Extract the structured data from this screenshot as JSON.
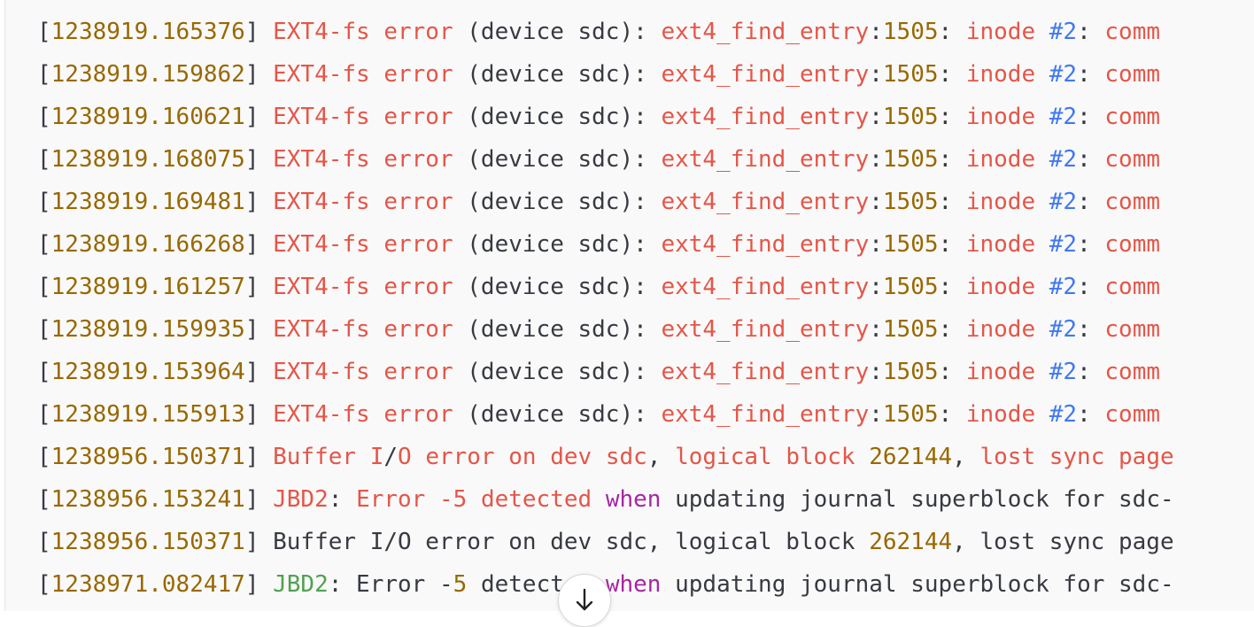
{
  "log_lines": [
    [
      {
        "t": "[",
        "c": "plain"
      },
      {
        "t": "1238919.165376",
        "c": "num"
      },
      {
        "t": "] ",
        "c": "plain"
      },
      {
        "t": "EXT4-fs error",
        "c": "red"
      },
      {
        "t": " (device sdc): ",
        "c": "plain"
      },
      {
        "t": "ext4_find_entry",
        "c": "red"
      },
      {
        "t": ":",
        "c": "plain"
      },
      {
        "t": "1505",
        "c": "num"
      },
      {
        "t": ": ",
        "c": "plain"
      },
      {
        "t": "inode",
        "c": "red"
      },
      {
        "t": " ",
        "c": "plain"
      },
      {
        "t": "#2",
        "c": "blue"
      },
      {
        "t": ": ",
        "c": "plain"
      },
      {
        "t": "comm",
        "c": "red"
      }
    ],
    [
      {
        "t": "[",
        "c": "plain"
      },
      {
        "t": "1238919.159862",
        "c": "num"
      },
      {
        "t": "] ",
        "c": "plain"
      },
      {
        "t": "EXT4-fs error",
        "c": "red"
      },
      {
        "t": " (device sdc): ",
        "c": "plain"
      },
      {
        "t": "ext4_find_entry",
        "c": "red"
      },
      {
        "t": ":",
        "c": "plain"
      },
      {
        "t": "1505",
        "c": "num"
      },
      {
        "t": ": ",
        "c": "plain"
      },
      {
        "t": "inode",
        "c": "red"
      },
      {
        "t": " ",
        "c": "plain"
      },
      {
        "t": "#2",
        "c": "blue"
      },
      {
        "t": ": ",
        "c": "plain"
      },
      {
        "t": "comm",
        "c": "red"
      }
    ],
    [
      {
        "t": "[",
        "c": "plain"
      },
      {
        "t": "1238919.160621",
        "c": "num"
      },
      {
        "t": "] ",
        "c": "plain"
      },
      {
        "t": "EXT4-fs error",
        "c": "red"
      },
      {
        "t": " (device sdc): ",
        "c": "plain"
      },
      {
        "t": "ext4_find_entry",
        "c": "red"
      },
      {
        "t": ":",
        "c": "plain"
      },
      {
        "t": "1505",
        "c": "num"
      },
      {
        "t": ": ",
        "c": "plain"
      },
      {
        "t": "inode",
        "c": "red"
      },
      {
        "t": " ",
        "c": "plain"
      },
      {
        "t": "#2",
        "c": "blue"
      },
      {
        "t": ": ",
        "c": "plain"
      },
      {
        "t": "comm",
        "c": "red"
      }
    ],
    [
      {
        "t": "[",
        "c": "plain"
      },
      {
        "t": "1238919.168075",
        "c": "num"
      },
      {
        "t": "] ",
        "c": "plain"
      },
      {
        "t": "EXT4-fs error",
        "c": "red"
      },
      {
        "t": " (device sdc): ",
        "c": "plain"
      },
      {
        "t": "ext4_find_entry",
        "c": "red"
      },
      {
        "t": ":",
        "c": "plain"
      },
      {
        "t": "1505",
        "c": "num"
      },
      {
        "t": ": ",
        "c": "plain"
      },
      {
        "t": "inode",
        "c": "red"
      },
      {
        "t": " ",
        "c": "plain"
      },
      {
        "t": "#2",
        "c": "blue"
      },
      {
        "t": ": ",
        "c": "plain"
      },
      {
        "t": "comm",
        "c": "red"
      }
    ],
    [
      {
        "t": "[",
        "c": "plain"
      },
      {
        "t": "1238919.169481",
        "c": "num"
      },
      {
        "t": "] ",
        "c": "plain"
      },
      {
        "t": "EXT4-fs error",
        "c": "red"
      },
      {
        "t": " (device sdc): ",
        "c": "plain"
      },
      {
        "t": "ext4_find_entry",
        "c": "red"
      },
      {
        "t": ":",
        "c": "plain"
      },
      {
        "t": "1505",
        "c": "num"
      },
      {
        "t": ": ",
        "c": "plain"
      },
      {
        "t": "inode",
        "c": "red"
      },
      {
        "t": " ",
        "c": "plain"
      },
      {
        "t": "#2",
        "c": "blue"
      },
      {
        "t": ": ",
        "c": "plain"
      },
      {
        "t": "comm",
        "c": "red"
      }
    ],
    [
      {
        "t": "[",
        "c": "plain"
      },
      {
        "t": "1238919.166268",
        "c": "num"
      },
      {
        "t": "] ",
        "c": "plain"
      },
      {
        "t": "EXT4-fs error",
        "c": "red"
      },
      {
        "t": " (device sdc): ",
        "c": "plain"
      },
      {
        "t": "ext4_find_entry",
        "c": "red"
      },
      {
        "t": ":",
        "c": "plain"
      },
      {
        "t": "1505",
        "c": "num"
      },
      {
        "t": ": ",
        "c": "plain"
      },
      {
        "t": "inode",
        "c": "red"
      },
      {
        "t": " ",
        "c": "plain"
      },
      {
        "t": "#2",
        "c": "blue"
      },
      {
        "t": ": ",
        "c": "plain"
      },
      {
        "t": "comm",
        "c": "red"
      }
    ],
    [
      {
        "t": "[",
        "c": "plain"
      },
      {
        "t": "1238919.161257",
        "c": "num"
      },
      {
        "t": "] ",
        "c": "plain"
      },
      {
        "t": "EXT4-fs error",
        "c": "red"
      },
      {
        "t": " (device sdc): ",
        "c": "plain"
      },
      {
        "t": "ext4_find_entry",
        "c": "red"
      },
      {
        "t": ":",
        "c": "plain"
      },
      {
        "t": "1505",
        "c": "num"
      },
      {
        "t": ": ",
        "c": "plain"
      },
      {
        "t": "inode",
        "c": "red"
      },
      {
        "t": " ",
        "c": "plain"
      },
      {
        "t": "#2",
        "c": "blue"
      },
      {
        "t": ": ",
        "c": "plain"
      },
      {
        "t": "comm",
        "c": "red"
      }
    ],
    [
      {
        "t": "[",
        "c": "plain"
      },
      {
        "t": "1238919.159935",
        "c": "num"
      },
      {
        "t": "] ",
        "c": "plain"
      },
      {
        "t": "EXT4-fs error",
        "c": "red"
      },
      {
        "t": " (device sdc): ",
        "c": "plain"
      },
      {
        "t": "ext4_find_entry",
        "c": "red"
      },
      {
        "t": ":",
        "c": "plain"
      },
      {
        "t": "1505",
        "c": "num"
      },
      {
        "t": ": ",
        "c": "plain"
      },
      {
        "t": "inode",
        "c": "red"
      },
      {
        "t": " ",
        "c": "plain"
      },
      {
        "t": "#2",
        "c": "blue"
      },
      {
        "t": ": ",
        "c": "plain"
      },
      {
        "t": "comm",
        "c": "red"
      }
    ],
    [
      {
        "t": "[",
        "c": "plain"
      },
      {
        "t": "1238919.153964",
        "c": "num"
      },
      {
        "t": "] ",
        "c": "plain"
      },
      {
        "t": "EXT4-fs error",
        "c": "red"
      },
      {
        "t": " (device sdc): ",
        "c": "plain"
      },
      {
        "t": "ext4_find_entry",
        "c": "red"
      },
      {
        "t": ":",
        "c": "plain"
      },
      {
        "t": "1505",
        "c": "num"
      },
      {
        "t": ": ",
        "c": "plain"
      },
      {
        "t": "inode",
        "c": "red"
      },
      {
        "t": " ",
        "c": "plain"
      },
      {
        "t": "#2",
        "c": "blue"
      },
      {
        "t": ": ",
        "c": "plain"
      },
      {
        "t": "comm",
        "c": "red"
      }
    ],
    [
      {
        "t": "[",
        "c": "plain"
      },
      {
        "t": "1238919.155913",
        "c": "num"
      },
      {
        "t": "] ",
        "c": "plain"
      },
      {
        "t": "EXT4-fs error",
        "c": "red"
      },
      {
        "t": " (device sdc): ",
        "c": "plain"
      },
      {
        "t": "ext4_find_entry",
        "c": "red"
      },
      {
        "t": ":",
        "c": "plain"
      },
      {
        "t": "1505",
        "c": "num"
      },
      {
        "t": ": ",
        "c": "plain"
      },
      {
        "t": "inode",
        "c": "red"
      },
      {
        "t": " ",
        "c": "plain"
      },
      {
        "t": "#2",
        "c": "blue"
      },
      {
        "t": ": ",
        "c": "plain"
      },
      {
        "t": "comm",
        "c": "red"
      }
    ],
    [
      {
        "t": "[",
        "c": "plain"
      },
      {
        "t": "1238956.150371",
        "c": "num"
      },
      {
        "t": "] ",
        "c": "plain"
      },
      {
        "t": "Buffer I",
        "c": "red"
      },
      {
        "t": "/",
        "c": "plain"
      },
      {
        "t": "O error on dev sdc",
        "c": "red"
      },
      {
        "t": ", ",
        "c": "plain"
      },
      {
        "t": "logical block ",
        "c": "red"
      },
      {
        "t": "262144",
        "c": "num"
      },
      {
        "t": ", ",
        "c": "plain"
      },
      {
        "t": "lost sync page",
        "c": "red"
      }
    ],
    [
      {
        "t": "[",
        "c": "plain"
      },
      {
        "t": "1238956.153241",
        "c": "num"
      },
      {
        "t": "] ",
        "c": "plain"
      },
      {
        "t": "JBD2",
        "c": "red"
      },
      {
        "t": ": ",
        "c": "plain"
      },
      {
        "t": "Error -5 detected",
        "c": "red"
      },
      {
        "t": " ",
        "c": "plain"
      },
      {
        "t": "when",
        "c": "purp"
      },
      {
        "t": " updating journal superblock for sdc-",
        "c": "plain"
      }
    ],
    [
      {
        "t": "[",
        "c": "plain"
      },
      {
        "t": "1238956.150371",
        "c": "num"
      },
      {
        "t": "] ",
        "c": "plain"
      },
      {
        "t": "Buffer I/O error on dev sdc, logical block ",
        "c": "plain"
      },
      {
        "t": "262144",
        "c": "num"
      },
      {
        "t": ", lost sync page",
        "c": "plain"
      }
    ],
    [
      {
        "t": "[",
        "c": "plain"
      },
      {
        "t": "1238971.082417",
        "c": "num"
      },
      {
        "t": "] ",
        "c": "plain"
      },
      {
        "t": "JBD2",
        "c": "green"
      },
      {
        "t": ": Error -",
        "c": "plain"
      },
      {
        "t": "5",
        "c": "num"
      },
      {
        "t": " detected ",
        "c": "plain"
      },
      {
        "t": "when",
        "c": "purp"
      },
      {
        "t": " updating journal superblock for sdc-",
        "c": "plain"
      }
    ]
  ],
  "token_colors": {
    "plain": "#383a42",
    "num": "#986801",
    "red": "#e45649",
    "blue": "#4078f2",
    "purp": "#a626a4",
    "green": "#50a14f"
  },
  "scroll_button": {
    "icon": "arrow-down-icon"
  }
}
